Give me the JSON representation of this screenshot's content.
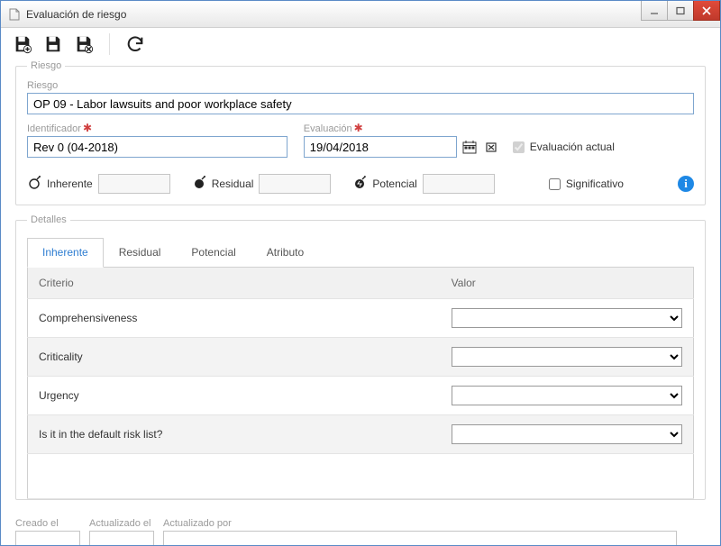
{
  "window": {
    "title": "Evaluación de riesgo"
  },
  "fieldset": {
    "riesgo_legend": "Riesgo",
    "riesgo_label": "Riesgo",
    "riesgo_value": "OP 09 - Labor lawsuits and poor workplace safety",
    "identificador_label": "Identificador",
    "identificador_value": "Rev 0 (04-2018)",
    "evaluacion_label": "Evaluación",
    "evaluacion_value": "19/04/2018",
    "evaluacion_actual_label": "Evaluación actual",
    "evaluacion_actual_checked": true,
    "inherente_label": "Inherente",
    "residual_label": "Residual",
    "potencial_label": "Potencial",
    "significativo_label": "Significativo"
  },
  "detalles": {
    "legend": "Detalles",
    "tabs": [
      "Inherente",
      "Residual",
      "Potencial",
      "Atributo"
    ],
    "active_tab": 0,
    "columns": {
      "criterio": "Criterio",
      "valor": "Valor"
    },
    "rows": [
      {
        "criterio": "Comprehensiveness",
        "valor": ""
      },
      {
        "criterio": "Criticality",
        "valor": ""
      },
      {
        "criterio": "Urgency",
        "valor": ""
      },
      {
        "criterio": "Is it in the default risk list?",
        "valor": ""
      }
    ]
  },
  "footer": {
    "creado_label": "Creado el",
    "creado_value": "",
    "actualizado_label": "Actualizado el",
    "actualizado_value": "",
    "actualizado_por_label": "Actualizado por",
    "actualizado_por_value": ""
  }
}
